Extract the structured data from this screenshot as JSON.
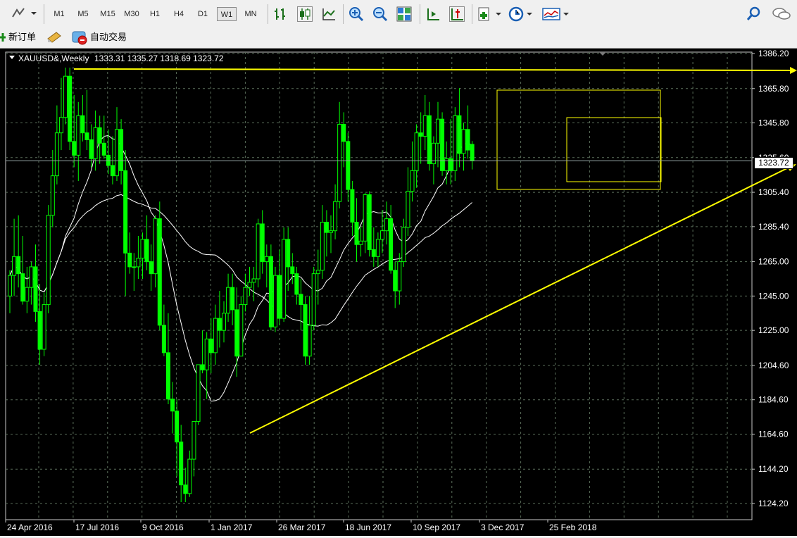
{
  "toolbar": {
    "timeframes": [
      "M1",
      "M5",
      "M15",
      "M30",
      "H1",
      "H4",
      "D1",
      "W1",
      "MN"
    ],
    "active_timeframe": "W1"
  },
  "toolbar2": {
    "new_order_label": "新订单",
    "auto_trading_label": "自动交易"
  },
  "chart_header": {
    "symbol_label": "XAUUSD&,Weekly",
    "ohlc_label": "1333.31 1335.27 1318.69 1323.72",
    "current_price_label": "1323.72"
  },
  "colors": {
    "background": "#000000",
    "candle": "#00ff00",
    "ma": "#ffffff",
    "trendline": "#ffff00",
    "grid": "#5a6e5a"
  },
  "chart_data": {
    "type": "candlestick",
    "symbol": "XAUUSD&",
    "timeframe": "Weekly",
    "last_ohlc": {
      "open": 1333.31,
      "high": 1335.27,
      "low": 1318.69,
      "close": 1323.72
    },
    "y_ticks": [
      1386.2,
      1365.8,
      1345.8,
      1325.6,
      1305.4,
      1285.4,
      1265.0,
      1245.0,
      1225.0,
      1204.6,
      1184.6,
      1164.6,
      1144.2,
      1124.2
    ],
    "x_labels": [
      "24 Apr 2016",
      "17 Jul 2016",
      "9 Oct 2016",
      "1 Jan 2017",
      "26 Mar 2017",
      "18 Jun 2017",
      "10 Sep 2017",
      "3 Dec 2017",
      "25 Feb 2018"
    ],
    "ylim": [
      1117,
      1392
    ],
    "grid": true,
    "candles": [
      [
        1245,
        1260,
        1235,
        1257
      ],
      [
        1257,
        1290,
        1245,
        1268
      ],
      [
        1268,
        1292,
        1250,
        1258
      ],
      [
        1258,
        1280,
        1240,
        1242
      ],
      [
        1242,
        1262,
        1235,
        1250
      ],
      [
        1250,
        1265,
        1240,
        1262
      ],
      [
        1262,
        1275,
        1230,
        1236
      ],
      [
        1236,
        1252,
        1205,
        1214
      ],
      [
        1214,
        1247,
        1210,
        1240
      ],
      [
        1240,
        1298,
        1235,
        1292
      ],
      [
        1292,
        1330,
        1285,
        1315
      ],
      [
        1315,
        1356,
        1310,
        1340
      ],
      [
        1340,
        1372,
        1330,
        1349
      ],
      [
        1349,
        1378,
        1345,
        1373
      ],
      [
        1373,
        1378,
        1330,
        1335
      ],
      [
        1335,
        1362,
        1320,
        1327
      ],
      [
        1327,
        1358,
        1312,
        1350
      ],
      [
        1350,
        1362,
        1335,
        1340
      ],
      [
        1340,
        1365,
        1330,
        1336
      ],
      [
        1336,
        1345,
        1320,
        1325
      ],
      [
        1325,
        1353,
        1318,
        1343
      ],
      [
        1343,
        1350,
        1322,
        1334
      ],
      [
        1334,
        1350,
        1325,
        1327
      ],
      [
        1327,
        1342,
        1316,
        1321
      ],
      [
        1321,
        1338,
        1310,
        1315
      ],
      [
        1315,
        1355,
        1312,
        1342
      ],
      [
        1342,
        1348,
        1310,
        1318
      ],
      [
        1318,
        1330,
        1245,
        1270
      ],
      [
        1270,
        1282,
        1258,
        1262
      ],
      [
        1262,
        1270,
        1248,
        1262
      ],
      [
        1262,
        1280,
        1255,
        1267
      ],
      [
        1267,
        1282,
        1255,
        1278
      ],
      [
        1278,
        1292,
        1260,
        1265
      ],
      [
        1265,
        1275,
        1248,
        1258
      ],
      [
        1258,
        1292,
        1250,
        1290
      ],
      [
        1290,
        1300,
        1225,
        1228
      ],
      [
        1228,
        1240,
        1210,
        1212
      ],
      [
        1212,
        1235,
        1182,
        1185
      ],
      [
        1185,
        1195,
        1165,
        1178
      ],
      [
        1178,
        1185,
        1140,
        1160
      ],
      [
        1160,
        1170,
        1125,
        1135
      ],
      [
        1135,
        1145,
        1125,
        1130
      ],
      [
        1130,
        1155,
        1128,
        1150
      ],
      [
        1150,
        1172,
        1140,
        1172
      ],
      [
        1172,
        1205,
        1170,
        1205
      ],
      [
        1205,
        1225,
        1200,
        1202
      ],
      [
        1202,
        1224,
        1185,
        1220
      ],
      [
        1220,
        1232,
        1200,
        1212
      ],
      [
        1212,
        1240,
        1205,
        1232
      ],
      [
        1232,
        1248,
        1215,
        1225
      ],
      [
        1225,
        1242,
        1218,
        1235
      ],
      [
        1235,
        1258,
        1230,
        1250
      ],
      [
        1250,
        1258,
        1228,
        1237
      ],
      [
        1237,
        1250,
        1198,
        1210
      ],
      [
        1210,
        1245,
        1210,
        1240
      ],
      [
        1240,
        1258,
        1236,
        1250
      ],
      [
        1250,
        1262,
        1245,
        1253
      ],
      [
        1253,
        1262,
        1242,
        1255
      ],
      [
        1255,
        1290,
        1250,
        1287
      ],
      [
        1287,
        1295,
        1258,
        1265
      ],
      [
        1265,
        1275,
        1250,
        1268
      ],
      [
        1268,
        1275,
        1225,
        1227
      ],
      [
        1227,
        1262,
        1224,
        1257
      ],
      [
        1257,
        1272,
        1228,
        1232
      ],
      [
        1232,
        1285,
        1230,
        1278
      ],
      [
        1278,
        1285,
        1248,
        1262
      ],
      [
        1262,
        1270,
        1252,
        1258
      ],
      [
        1258,
        1262,
        1240,
        1246
      ],
      [
        1246,
        1255,
        1225,
        1240
      ],
      [
        1240,
        1245,
        1205,
        1210
      ],
      [
        1210,
        1245,
        1205,
        1228
      ],
      [
        1228,
        1262,
        1225,
        1258
      ],
      [
        1258,
        1272,
        1240,
        1260
      ],
      [
        1260,
        1298,
        1255,
        1288
      ],
      [
        1288,
        1295,
        1268,
        1282
      ],
      [
        1282,
        1292,
        1270,
        1283
      ],
      [
        1283,
        1310,
        1278,
        1300
      ],
      [
        1300,
        1358,
        1296,
        1345
      ],
      [
        1345,
        1352,
        1320,
        1335
      ],
      [
        1335,
        1340,
        1300,
        1307
      ],
      [
        1307,
        1312,
        1280,
        1288
      ],
      [
        1288,
        1302,
        1265,
        1275
      ],
      [
        1275,
        1285,
        1268,
        1277
      ],
      [
        1277,
        1305,
        1270,
        1304
      ],
      [
        1304,
        1306,
        1268,
        1272
      ],
      [
        1272,
        1285,
        1262,
        1268
      ],
      [
        1268,
        1282,
        1262,
        1278
      ],
      [
        1278,
        1295,
        1270,
        1283
      ],
      [
        1283,
        1300,
        1275,
        1290
      ],
      [
        1290,
        1298,
        1258,
        1260
      ],
      [
        1260,
        1265,
        1238,
        1248
      ],
      [
        1248,
        1270,
        1240,
        1265
      ],
      [
        1265,
        1290,
        1262,
        1285
      ],
      [
        1285,
        1320,
        1280,
        1306
      ],
      [
        1306,
        1335,
        1300,
        1318
      ],
      [
        1318,
        1345,
        1308,
        1340
      ],
      [
        1340,
        1352,
        1322,
        1338
      ],
      [
        1338,
        1362,
        1330,
        1350
      ],
      [
        1350,
        1358,
        1318,
        1322
      ],
      [
        1322,
        1338,
        1310,
        1334
      ],
      [
        1334,
        1358,
        1320,
        1348
      ],
      [
        1348,
        1352,
        1315,
        1318
      ],
      [
        1318,
        1335,
        1310,
        1325
      ],
      [
        1325,
        1348,
        1310,
        1318
      ],
      [
        1318,
        1355,
        1312,
        1350
      ],
      [
        1350,
        1366,
        1320,
        1328
      ],
      [
        1328,
        1346,
        1318,
        1342
      ],
      [
        1342,
        1356,
        1325,
        1330
      ],
      [
        1333.31,
        1335.27,
        1318.69,
        1323.72
      ]
    ],
    "trendlines": [
      {
        "from": [
          "24 Jul 2016",
          1377
        ],
        "to": [
          "beyond right edge",
          1376
        ]
      },
      {
        "from": [
          "8 Jan 2017",
          1166
        ],
        "to": [
          "beyond right edge",
          1325
        ]
      }
    ],
    "rectangles": [
      {
        "x0": "15 Oct 2017",
        "x1": "20 Jan 2018",
        "y0": 1309,
        "y1": 1366
      },
      {
        "x0": "7 Jan 2018",
        "x1": "20 Jan 2018",
        "y0": 1310,
        "y1": 1347
      }
    ]
  }
}
